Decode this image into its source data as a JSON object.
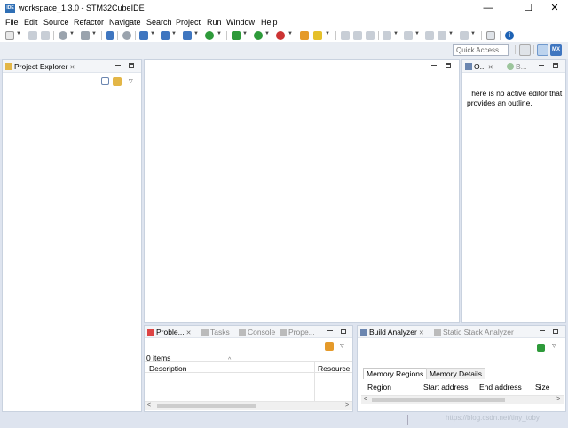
{
  "window": {
    "app_icon_text": "IDE",
    "title": "workspace_1.3.0 - STM32CubeIDE",
    "minimize": "—",
    "maximize": "☐",
    "close": "✕"
  },
  "menu": [
    "File",
    "Edit",
    "Source",
    "Refactor",
    "Navigate",
    "Search",
    "Project",
    "Run",
    "Window",
    "Help"
  ],
  "toolbar": {
    "icons": [
      "new-icon",
      "save-icon",
      "save-all-icon",
      "build-icon",
      "build-configs-icon",
      "skip-breakpoints-icon",
      "new-project-icon",
      "new-cpp-class-icon",
      "new-file-icon",
      "open-type-icon",
      "refresh-icon",
      "debug-icon",
      "run-icon",
      "stop-icon",
      "external-tools-icon",
      "search-icon",
      "next-annotation-icon",
      "prev-annotation-icon",
      "last-edit-icon",
      "back-icon",
      "forward-icon",
      "pin-icon",
      "info-icon"
    ],
    "colors": {
      "blue": "#3f76c0",
      "green": "#2e9a3a",
      "red": "#cc3333",
      "orange": "#e59a2a",
      "gray": "#9aa3ad"
    }
  },
  "quick_access": {
    "placeholder": "Quick Access"
  },
  "perspectives": {
    "icons": [
      "open-perspective-icon",
      "cpp-perspective-icon",
      "mx-perspective-icon"
    ],
    "mx_label": "MX"
  },
  "project_explorer": {
    "tab_label": "Project Explorer",
    "close": "✕",
    "toolbar": [
      "collapse-all-icon",
      "link-editor-icon",
      "view-menu-icon"
    ]
  },
  "editor_area": {},
  "outline": {
    "tab1_label": "O...",
    "tab2_label": "B...",
    "close": "✕",
    "message": "There is no active editor that provides an outline."
  },
  "problems": {
    "tabs": [
      {
        "label": "Proble...",
        "active": true
      },
      {
        "label": "Tasks",
        "active": false
      },
      {
        "label": "Console",
        "active": false
      },
      {
        "label": "Prope...",
        "active": false
      }
    ],
    "close": "✕",
    "items_count": "0 items",
    "columns": [
      "Description",
      "Resource"
    ]
  },
  "build_analyzer": {
    "tabs": [
      {
        "label": "Build Analyzer",
        "active": true
      },
      {
        "label": "Static Stack Analyzer",
        "active": false
      }
    ],
    "close": "✕",
    "sub_tabs": [
      "Memory Regions",
      "Memory Details"
    ],
    "columns": [
      "Region",
      "Start address",
      "End address",
      "Size"
    ]
  },
  "statusbar": {
    "watermark": "https://blog.csdn.net/tiny_toby"
  }
}
